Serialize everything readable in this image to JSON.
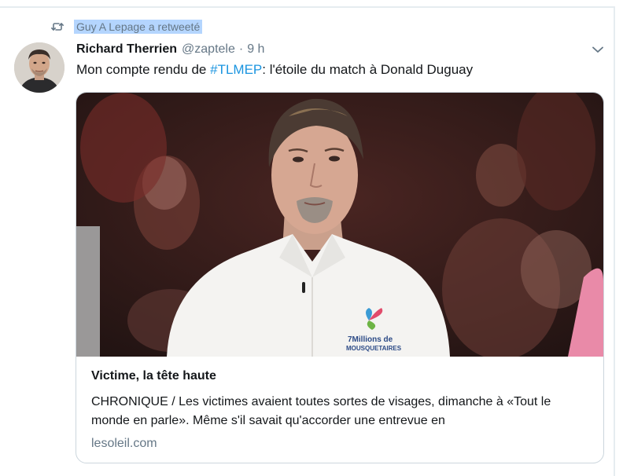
{
  "retweet": {
    "text": "Guy A Lepage a retweeté"
  },
  "tweet": {
    "author_name": "Richard Therrien",
    "author_handle": "@zaptele",
    "separator": "·",
    "time": "9 h",
    "text_prefix": "Mon compte rendu de ",
    "hashtag": "#TLMEP",
    "text_suffix": ": l'étoile du match à Donald Duguay"
  },
  "card": {
    "title": "Victime, la tête haute",
    "description": "CHRONIQUE / Les victimes avaient toutes sortes de visages, dimanche à «Tout le monde en parle». Même s'il savait qu'accorder une entrevue en",
    "domain": "lesoleil.com",
    "shirt_logo_line1": "7Millions de",
    "shirt_logo_line2": "MOUSQUETAIRES"
  },
  "colors": {
    "link": "#1b95e0",
    "muted": "#657786",
    "highlight": "#b4d5fe",
    "border": "#ccd6dd"
  },
  "icons": {
    "retweet": "retweet-icon",
    "menu": "chevron-down-icon"
  }
}
